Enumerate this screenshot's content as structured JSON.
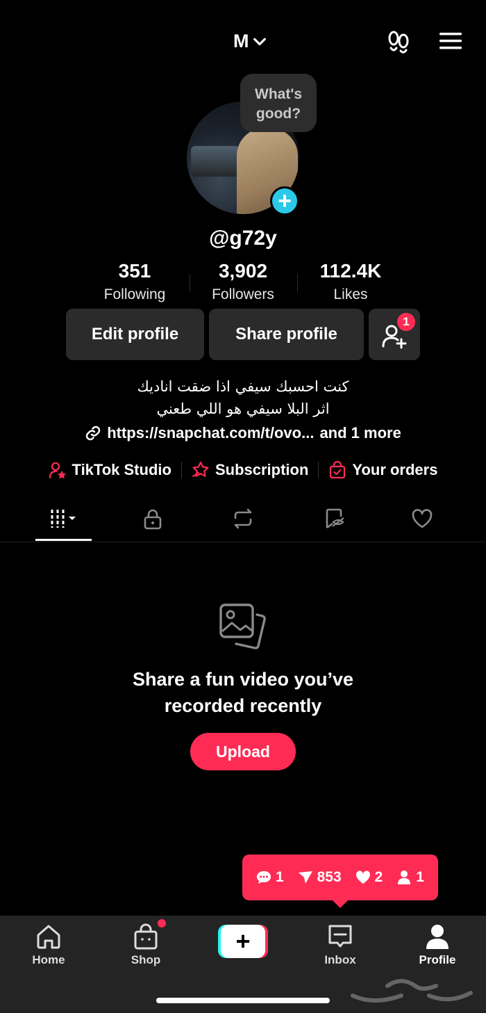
{
  "header": {
    "account_initial": "M"
  },
  "avatar": {
    "status_bubble": "What's good?",
    "add_symbol": "+"
  },
  "profile": {
    "username": "@g72y"
  },
  "stats": [
    {
      "value": "351",
      "label": "Following"
    },
    {
      "value": "3,902",
      "label": "Followers"
    },
    {
      "value": "112.4K",
      "label": "Likes"
    }
  ],
  "buttons": {
    "edit_profile": "Edit profile",
    "share_profile": "Share profile",
    "add_friend_badge": "1"
  },
  "bio": {
    "line1": "كنت احسبك سيفي اذا ضقت اناديك",
    "line2": "اثر البلا سيفي هو اللي طعني"
  },
  "link": {
    "url": "https://snapchat.com/t/ovo...",
    "more": "and 1 more"
  },
  "tools": [
    {
      "label": "TikTok Studio",
      "icon": "person-star-icon"
    },
    {
      "label": "Subscription",
      "icon": "star-ribbon-icon"
    },
    {
      "label": "Your orders",
      "icon": "shopping-bag-icon"
    }
  ],
  "tabs": [
    "videos-grid",
    "private-lock",
    "reposts",
    "favorites",
    "liked"
  ],
  "empty_state": {
    "line1": "Share a fun video you’ve",
    "line2": "recorded recently",
    "upload": "Upload"
  },
  "notifications": {
    "comments": "1",
    "shares": "853",
    "likes": "2",
    "followers": "1"
  },
  "bottom_nav": [
    {
      "label": "Home"
    },
    {
      "label": "Shop"
    },
    {
      "label": "+"
    },
    {
      "label": "Inbox"
    },
    {
      "label": "Profile"
    }
  ],
  "colors": {
    "accent": "#fe2c55",
    "cyan": "#25f4ee",
    "avatar_add": "#2bc8e8",
    "button_bg": "#2b2b2b",
    "nav_bg": "#242424"
  }
}
